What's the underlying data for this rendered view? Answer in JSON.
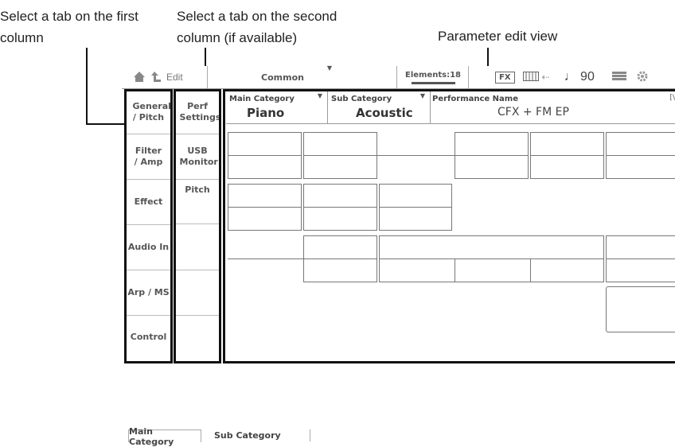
{
  "annotations": {
    "first_column": "Select a tab on the first column",
    "second_column": "Select a tab on the second column (if available)",
    "edit_view": "Parameter edit view"
  },
  "topbar": {
    "edit_label": "Edit",
    "part_label": "Common",
    "elements_label": "Elements:18",
    "fx_label": "FX",
    "tempo_value": "♩ 90",
    "icons": [
      "home-icon",
      "back-arrow-icon",
      "keyboard-icon",
      "usb-icon",
      "menu-icon",
      "gear-icon"
    ]
  },
  "first_column_tabs": [
    "General / Pitch",
    "Filter / Amp",
    "Effect",
    "Audio In",
    "Arp / MS",
    "Control"
  ],
  "second_column_tabs": [
    "Perf Settings",
    "USB Monitor",
    "Pitch",
    "",
    "",
    ""
  ],
  "edit_view": {
    "main_category_title": "Main Category",
    "main_category_value": "Piano",
    "sub_category_title": "Sub Category",
    "sub_category_value": "Acoustic",
    "performance_name_title": "Performance Name",
    "performance_name_value": "CFX + FM EP",
    "right_marker": "[\\"
  },
  "bottom_tabs": [
    "Main Category",
    "Sub Category"
  ]
}
